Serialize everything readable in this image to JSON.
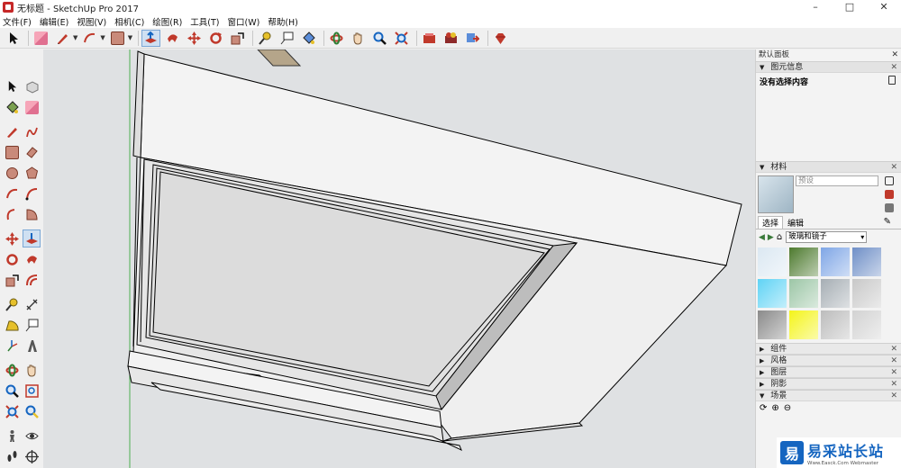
{
  "window": {
    "title": "无标题 - SketchUp Pro 2017",
    "controls": {
      "minimize": "–",
      "maximize": "□",
      "close": "✕"
    }
  },
  "menu": [
    "文件(F)",
    "编辑(E)",
    "视图(V)",
    "相机(C)",
    "绘图(R)",
    "工具(T)",
    "窗口(W)",
    "帮助(H)"
  ],
  "tray": {
    "title": "默认面板",
    "entity_info": {
      "header": "图元信息",
      "content": "没有选择内容"
    },
    "materials": {
      "header": "材料",
      "name_placeholder": "预设",
      "tabs": [
        "选择",
        "编辑"
      ],
      "active_tab": "选择",
      "collection": "玻璃和镜子",
      "swatch_colors": [
        [
          "#dbe8f2",
          "#4d7a2e",
          "#7fa6e6",
          "#6f8fc7"
        ],
        [
          "#5fd3f5",
          "#9cc6a6",
          "#a6aeb4",
          "#c8c8c8"
        ],
        [
          "#8a8a8a",
          "#f4f41a",
          "#bcbcbc",
          "#d2d2d2"
        ]
      ]
    },
    "collapsed_panels": [
      "组件",
      "风格",
      "图层",
      "阴影"
    ],
    "scenes": {
      "header": "场景"
    }
  },
  "watermark": {
    "logo": "易",
    "text": "易采站长站",
    "subtext": "Www.Easck.Com Webmaster"
  },
  "colors": {
    "viewport_bg": "#dfe1e3",
    "model_face": "#f4f4f4",
    "model_edge": "#000000",
    "accent": "#7aa7d6"
  }
}
